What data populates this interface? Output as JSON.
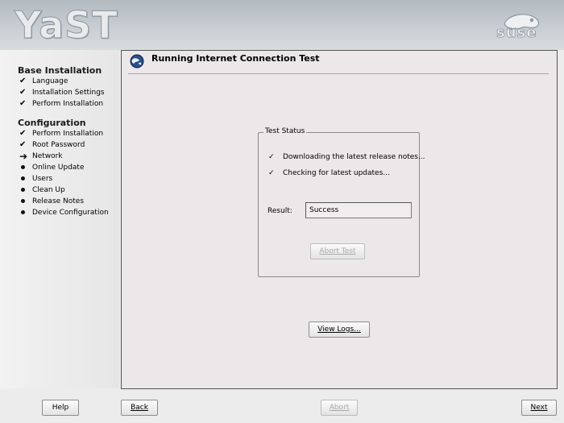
{
  "header": {
    "app_logo": "YaST",
    "brand_logo": "suse"
  },
  "sidebar": {
    "sections": [
      {
        "title": "Base Installation",
        "steps": [
          {
            "label": "Language",
            "state": "done"
          },
          {
            "label": "Installation Settings",
            "state": "done"
          },
          {
            "label": "Perform Installation",
            "state": "done"
          }
        ]
      },
      {
        "title": "Configuration",
        "steps": [
          {
            "label": "Perform Installation",
            "state": "done"
          },
          {
            "label": "Root Password",
            "state": "done"
          },
          {
            "label": "Network",
            "state": "current"
          },
          {
            "label": "Online Update",
            "state": "pending"
          },
          {
            "label": "Users",
            "state": "pending"
          },
          {
            "label": "Clean Up",
            "state": "pending"
          },
          {
            "label": "Release Notes",
            "state": "pending"
          },
          {
            "label": "Device Configuration",
            "state": "pending"
          }
        ]
      }
    ]
  },
  "main": {
    "title": "Running Internet Connection Test",
    "title_icon": "globe-icon",
    "test_status": {
      "legend": "Test Status",
      "checks": [
        {
          "label": "Downloading the latest release notes...",
          "state": "done"
        },
        {
          "label": "Checking for latest updates...",
          "state": "done"
        }
      ],
      "result_label": "Result:",
      "result_value": "Success",
      "abort_test_label": "Abort Test"
    },
    "view_logs_label": "View Logs..."
  },
  "footer": {
    "help_label": "Help",
    "back_label": "Back",
    "abort_label": "Abort",
    "next_label": "Next"
  },
  "colors": {
    "header_gradient_top": "#b2bac0",
    "panel_bg": "#ece7e9",
    "disabled_text": "#a9a9a9"
  }
}
